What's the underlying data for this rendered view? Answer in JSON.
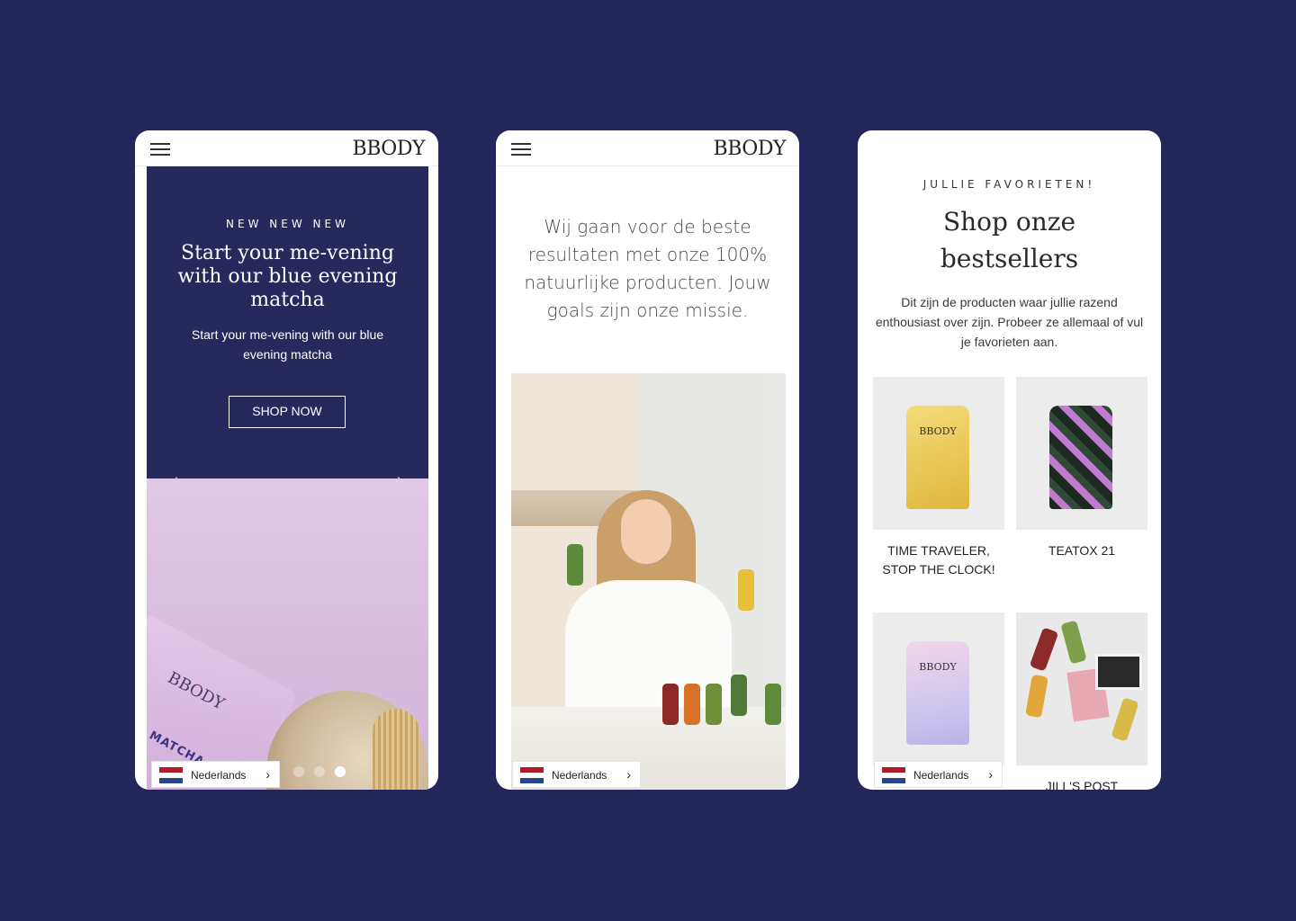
{
  "colors": {
    "background": "#24265a",
    "hero_navy": "#27285c"
  },
  "brand": {
    "logo": "BBODY"
  },
  "phone1": {
    "hero": {
      "eyebrow": "NEW NEW NEW",
      "title": "Start your me-vening with our blue evening matcha",
      "subtitle": "Start your me-vening with our blue evening matcha",
      "cta": "SHOP NOW",
      "prev_icon": "‹",
      "next_icon": "›"
    },
    "product": {
      "logo": "BBODY",
      "name": "BLUE MATCHA"
    },
    "slider": {
      "slide_count": 3,
      "active_index": 3
    }
  },
  "phone2": {
    "mission": "Wij gaan voor de beste resultaten met onze 100% natuurlijke producten. Jouw goals zijn onze missie."
  },
  "phone3": {
    "eyebrow": "JULLIE FAVORIETEN!",
    "title": "Shop onze bestsellers",
    "subtitle": "Dit zijn de producten waar jullie razend enthousiast over zijn. Probeer ze allemaal of vul je favorieten aan.",
    "products": [
      {
        "name": "TIME TRAVELER, STOP THE CLOCK!"
      },
      {
        "name": "TEATOX 21"
      },
      {
        "name": ""
      },
      {
        "name": "JILL'S POST"
      }
    ]
  },
  "language": {
    "label": "Nederlands",
    "chevron": "›"
  }
}
